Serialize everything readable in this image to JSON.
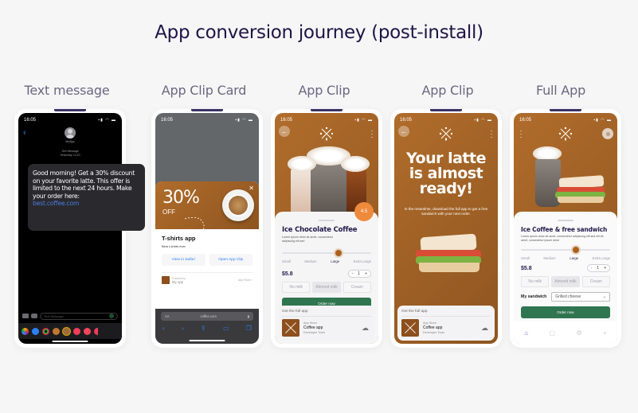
{
  "title": "App conversion journey (post-install)",
  "columns": [
    "Text message",
    "App Clip Card",
    "App Clip",
    "App Clip",
    "Full App"
  ],
  "status_time": "16:05",
  "sms": {
    "contact": "MoApp",
    "meta_line1": "Text Message",
    "meta_line2": "Yesterday 13:20",
    "message": "Good morning! Get a 30% discount on your favorite latte. This offer is limited to the next 24 hours. Make your order here:",
    "link": "best.coffee.com",
    "input_placeholder": "Text Message"
  },
  "clip_card": {
    "promo_big": "30%",
    "promo_small": "OFF",
    "app_name": "T-shirts app",
    "app_subtitle": "Best t-shirts ever",
    "btn_safari": "View in Safari",
    "btn_open": "Open App Clip",
    "powered_by": "Powered by",
    "powered_app": "My App",
    "app_store_link": "App Store ›",
    "url": "coffee.com",
    "aa": "AA"
  },
  "clip1": {
    "rating": "4.5",
    "product": "Ice Chocolate Coffee",
    "desc": "Lorem ipsum dolor sit amet, consectetur adipiscing elit sed",
    "sizes": [
      "Small",
      "Medium",
      "Large",
      "Extra Large"
    ],
    "selected_size": "Large",
    "price": "$5.8",
    "quantity": "1",
    "milk": [
      "No milk",
      "Almond milk",
      "Cream"
    ],
    "selected_milk": "Almond milk",
    "order_label": "Order now"
  },
  "get_full_app": {
    "label": "Get the full app",
    "store": "App Store",
    "name": "Coffee app",
    "developer": "Developer Tools"
  },
  "clip2": {
    "headline": "Your latte is almost ready!",
    "body": "In the meantime, download the full app to get a free sandwich with your next order."
  },
  "full_app": {
    "product": "Ice Coffee & free sandwich",
    "desc": "Lorem ipsum dolor sit amet, consectetur adipiscing elit sed elit sit amet, consectetur ipsum dolor",
    "sizes": [
      "Small",
      "Medium",
      "Large",
      "Extra Large"
    ],
    "price": "$5.8",
    "quantity": "1",
    "milk": [
      "No milk",
      "Almond milk",
      "Cream"
    ],
    "sandwich_label": "My sandwich",
    "sandwich_value": "Grilled cheese",
    "order_label": "Order now",
    "tabs": [
      "home",
      "bag",
      "settings",
      "add"
    ]
  },
  "colors": {
    "brand_brown": "#a9631f",
    "order_green": "#2f7550",
    "rating_orange": "#ee8a3c",
    "title_navy": "#1f1446",
    "link_blue": "#4a7bd9"
  }
}
